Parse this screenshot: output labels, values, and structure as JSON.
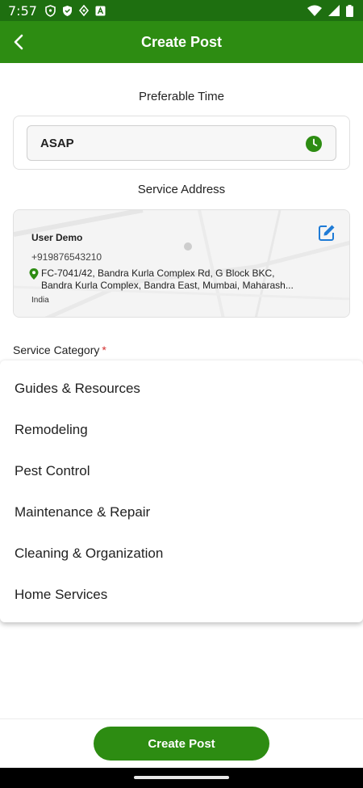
{
  "status_bar": {
    "time": "7:57",
    "icons_left": [
      "shield-icon",
      "shield-filled-icon",
      "location-icon",
      "text-a-icon"
    ],
    "icons_right": [
      "wifi-icon",
      "signal-icon",
      "battery-icon"
    ]
  },
  "app_bar": {
    "title": "Create Post",
    "back_icon": "arrow-left-icon",
    "background": "#2d8c12"
  },
  "preferable_time": {
    "label": "Preferable Time",
    "value": "ASAP",
    "icon": "clock-icon"
  },
  "service_address": {
    "label": "Service Address",
    "name": "User Demo",
    "phone": "+919876543210",
    "line1": "FC-7041/42, Bandra Kurla Complex Rd, G Block BKC,",
    "line2": "Bandra Kurla Complex, Bandra East, Mumbai, Maharash...",
    "country": "India",
    "edit_icon": "edit-icon"
  },
  "service_category": {
    "label": "Service Category",
    "required_mark": "*",
    "options": [
      "Guides & Resources",
      "Remodeling",
      "Pest Control",
      "Maintenance & Repair",
      "Cleaning & Organization",
      "Home Services"
    ]
  },
  "footer": {
    "button_label": "Create Post"
  },
  "colors": {
    "primary": "#2d8c12",
    "status_bar": "#1e6f10",
    "required": "#d32f2f",
    "edit_icon": "#1e7bd6"
  }
}
